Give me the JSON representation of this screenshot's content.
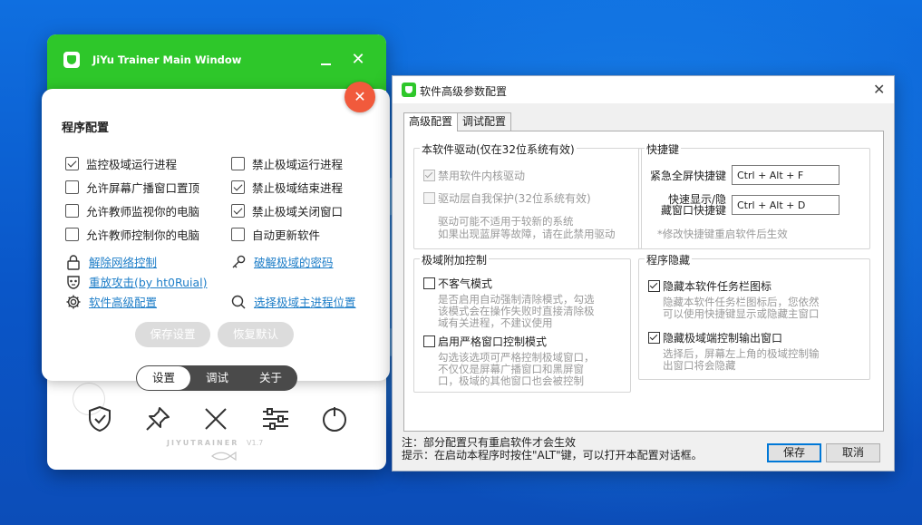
{
  "jiyu": {
    "title": "JiYu Trainer Main Window",
    "close_glyph": "✕",
    "card": {
      "heading": "程序配置",
      "checkboxes_left": [
        {
          "label": "监控极域运行进程",
          "checked": true
        },
        {
          "label": "允许屏幕广播窗口置顶",
          "checked": false
        },
        {
          "label": "允许教师监视你的电脑",
          "checked": false
        },
        {
          "label": "允许教师控制你的电脑",
          "checked": false
        }
      ],
      "checkboxes_right": [
        {
          "label": "禁止极域运行进程",
          "checked": false
        },
        {
          "label": "禁止极域结束进程",
          "checked": true
        },
        {
          "label": "禁止极域关闭窗口",
          "checked": true
        },
        {
          "label": "自动更新软件",
          "checked": false
        }
      ],
      "links": [
        {
          "label": "解除网络控制",
          "icon": "lock-icon"
        },
        {
          "label": "破解极域的密码",
          "icon": "key-icon"
        },
        {
          "label": "重放攻击(by ht0Ruial)",
          "icon": "mask-icon"
        },
        {
          "label": "软件高级配置",
          "icon": "gear-icon"
        },
        {
          "label": "选择极域主进程位置",
          "icon": "search-icon"
        }
      ],
      "save_button": "保存设置",
      "reset_button": "恢复默认"
    },
    "tabs": [
      "设置",
      "调试",
      "关于"
    ],
    "active_tab": "设置",
    "brand": "JIYUTRAINER",
    "version": "V1.7",
    "toolbar_icons": [
      "shield-icon",
      "pin-icon",
      "cross-icon",
      "sliders-icon",
      "power-icon"
    ]
  },
  "dialog": {
    "title": "软件高级参数配置",
    "tabs": [
      "高级配置",
      "调试配置"
    ],
    "active_tab": "高级配置",
    "driver_group": {
      "title": "本软件驱动(仅在32位系统有效)",
      "opt1": "禁用软件内核驱动",
      "opt1_checked": true,
      "opt2": "驱动层自我保护(32位系统有效)",
      "opt2_checked": false,
      "note1": "驱动可能不适用于较新的系统",
      "note2": "如果出现蓝屏等故障，请在此禁用驱动"
    },
    "hotkey_group": {
      "title": "快捷键",
      "fullscreen_label": "紧急全屏快捷键",
      "fullscreen_value": "Ctrl + Alt + F",
      "show_label_1": "快速显示/隐",
      "show_label_2": "藏窗口快捷键",
      "show_value": "Ctrl + Alt + D",
      "note": "*修改快捷键重启软件后生效"
    },
    "extra_group": {
      "title": "极域附加控制",
      "opt1": "不客气模式",
      "opt1_checked": false,
      "opt1_note1": "是否启用自动强制清除模式，勾选",
      "opt1_note2": "该模式会在操作失败时直接清除极",
      "opt1_note3": "域有关进程，不建议使用",
      "opt2": "启用严格窗口控制模式",
      "opt2_checked": false,
      "opt2_note1": "勾选该选项可严格控制极域窗口，",
      "opt2_note2": "不仅仅是屏幕广播窗口和黑屏窗",
      "opt2_note3": "口，极域的其他窗口也会被控制"
    },
    "hide_group": {
      "title": "程序隐藏",
      "opt1": "隐藏本软件任务栏图标",
      "opt1_checked": true,
      "opt1_note1": "隐藏本软件任务栏图标后，您依然",
      "opt1_note2": "可以使用快捷键显示或隐藏主窗口",
      "opt2": "隐藏极域端控制输出窗口",
      "opt2_checked": true,
      "opt2_note1": "选择后，屏幕左上角的极域控制输",
      "opt2_note2": "出窗口将会隐藏"
    },
    "footer_note1": "注：部分配置只有重启软件才会生效",
    "footer_note2": "提示：在启动本程序时按住\"ALT\"键，可以打开本配置对话框。",
    "save_button": "保存",
    "cancel_button": "取消"
  }
}
